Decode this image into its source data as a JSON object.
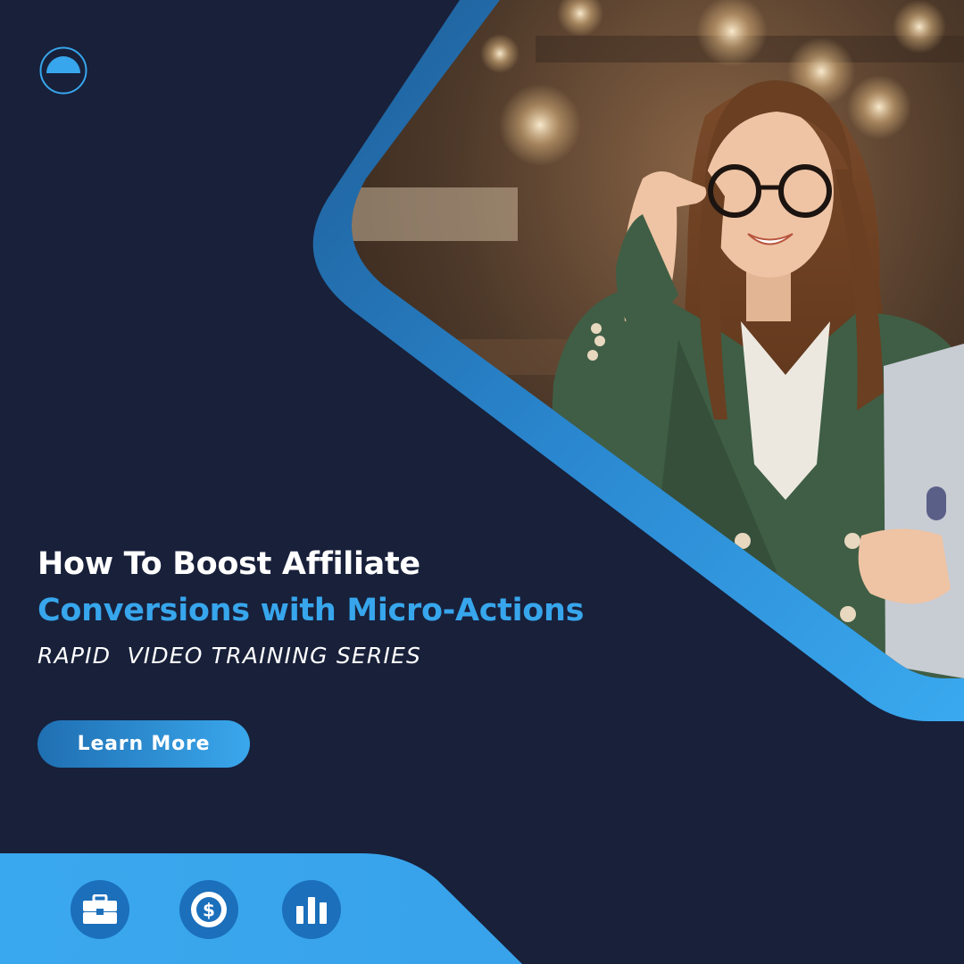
{
  "headline": {
    "line_1": "How To Boost Affiliate",
    "line_2": "Conversions with Micro-Actions"
  },
  "subtitle": "RAPID  VIDEO TRAINING SERIES",
  "cta": {
    "label": "Learn More"
  },
  "logo": {
    "icon": "half-circle-logo-icon"
  },
  "feature_icons": [
    "briefcase-icon",
    "dollar-coin-icon",
    "bar-chart-icon"
  ],
  "colors": {
    "background": "#18203a",
    "accent": "#37a6ec",
    "accent_dark": "#1f6fb2",
    "text": "#ffffff"
  }
}
